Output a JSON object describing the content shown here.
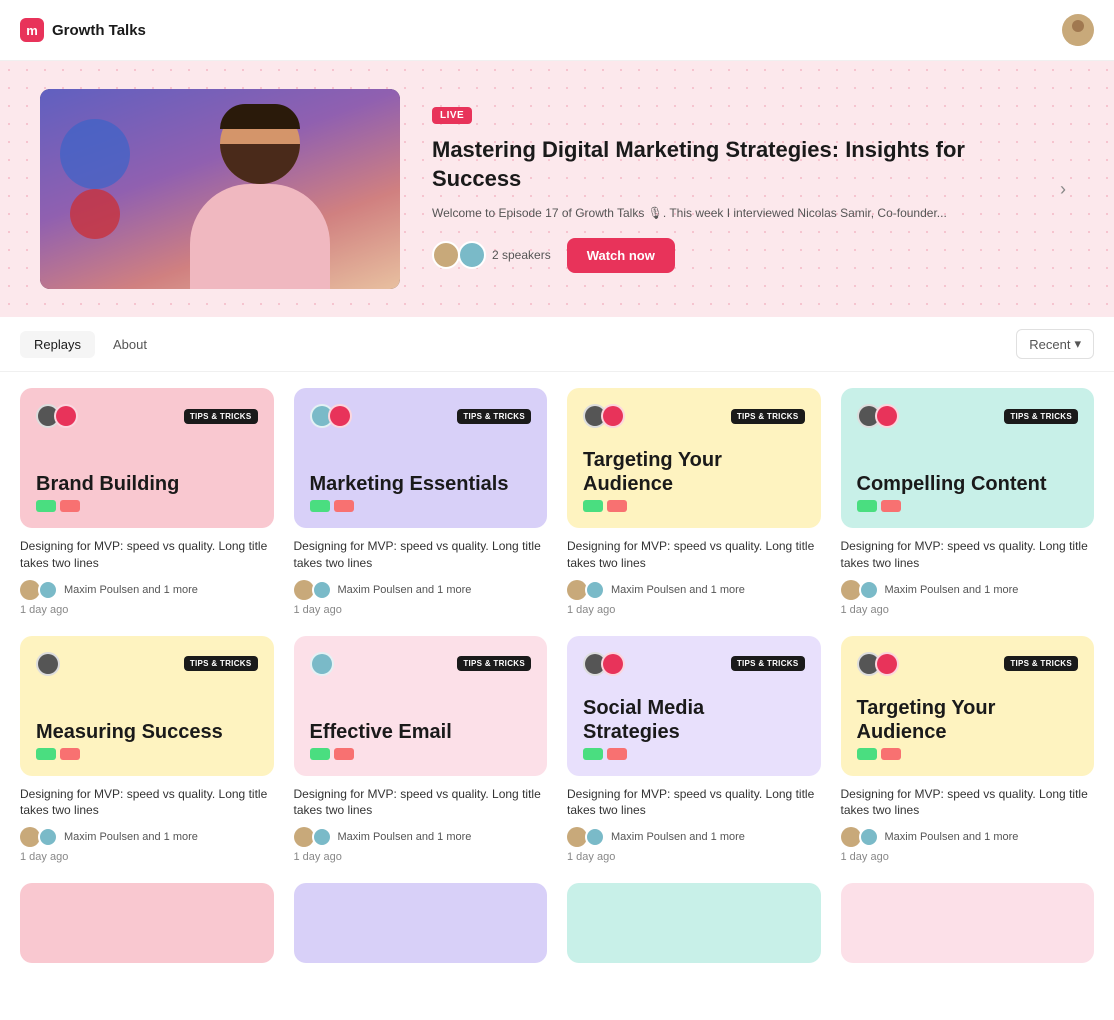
{
  "header": {
    "logo": "m",
    "title": "Growth Talks"
  },
  "hero": {
    "live_badge": "LIVE",
    "title": "Mastering Digital Marketing Strategies: Insights for Success",
    "description": "Welcome to Episode 17 of Growth Talks 🎙. This week I interviewed Nicolas Samir, Co-founder...",
    "speakers_count": "2 speakers",
    "watch_label": "Watch now"
  },
  "tabs": {
    "items": [
      "Replays",
      "About"
    ],
    "active": "Replays",
    "sort_label": "Recent"
  },
  "grid_row1": [
    {
      "bg": "pink",
      "title": "Brand Building",
      "badge": "TIPS & TRICKS",
      "avatars": [
        "ca1",
        "ca2"
      ],
      "tags": [
        "tag-green",
        "tag-red"
      ],
      "desc": "Designing for MVP: speed vs quality. Long title takes two lines",
      "author": "Maxim Poulsen and 1 more",
      "time": "1 day ago"
    },
    {
      "bg": "lavender",
      "title": "Marketing Essentials",
      "badge": "TIPS & TRICKS",
      "avatars": [
        "ca3",
        "ca2"
      ],
      "tags": [
        "tag-green",
        "tag-red"
      ],
      "desc": "Designing for MVP: speed vs quality. Long title takes two lines",
      "author": "Maxim Poulsen and 1 more",
      "time": "1 day ago"
    },
    {
      "bg": "yellow",
      "title": "Targeting Your Audience",
      "badge": "TIPS & TRICKS",
      "avatars": [
        "ca1",
        "ca2"
      ],
      "tags": [
        "tag-green",
        "tag-red"
      ],
      "desc": "Designing for MVP: speed vs quality. Long title takes two lines",
      "author": "Maxim Poulsen and 1 more",
      "time": "1 day ago"
    },
    {
      "bg": "mint",
      "title": "Compelling Content",
      "badge": "TIPS & TRICKS",
      "avatars": [
        "ca1",
        "ca2"
      ],
      "tags": [
        "tag-green",
        "tag-red"
      ],
      "desc": "Designing for MVP: speed vs quality. Long title takes two lines",
      "author": "Maxim Poulsen and 1 more",
      "time": "1 day ago"
    }
  ],
  "grid_row2": [
    {
      "bg": "yellow",
      "title": "Measuring Success",
      "badge": "TIPS & TRICKS",
      "avatars": [
        "ca1"
      ],
      "tags": [
        "tag-green",
        "tag-red"
      ],
      "desc": "Designing for MVP: speed vs quality. Long title takes two lines",
      "author": "Maxim Poulsen and 1 more",
      "time": "1 day ago"
    },
    {
      "bg": "soft-pink",
      "title": "Effective Email",
      "badge": "TIPS & TRICKS",
      "avatars": [
        "ca3"
      ],
      "tags": [
        "tag-green",
        "tag-red"
      ],
      "desc": "Designing for MVP: speed vs quality. Long title takes two lines",
      "author": "Maxim Poulsen and 1 more",
      "time": "1 day ago"
    },
    {
      "bg": "light-lavender",
      "title": "Social Media Strategies",
      "badge": "TIPS & TRICKS",
      "avatars": [
        "ca1",
        "ca2"
      ],
      "tags": [
        "tag-green",
        "tag-red"
      ],
      "desc": "Designing for MVP: speed vs quality. Long title takes two lines",
      "author": "Maxim Poulsen and 1 more",
      "time": "1 day ago"
    },
    {
      "bg": "yellow",
      "title": "Targeting Your Audience",
      "badge": "TIPS & TRICKS",
      "avatars": [
        "ca1",
        "ca2"
      ],
      "tags": [
        "tag-green",
        "tag-red"
      ],
      "desc": "Designing for MVP: speed vs quality. Long title takes two lines",
      "author": "Maxim Poulsen and 1 more",
      "time": "1 day ago"
    }
  ],
  "grid_row3": [
    {
      "bg": "pink"
    },
    {
      "bg": "lavender"
    },
    {
      "bg": "mint"
    },
    {
      "bg": "soft-pink"
    }
  ]
}
